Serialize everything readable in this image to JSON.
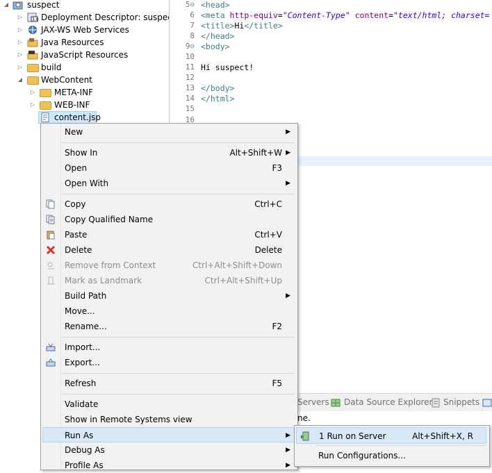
{
  "project_explorer": {
    "project": "suspect",
    "items": [
      {
        "label": "Deployment Descriptor: suspect",
        "icon": "deployment-descriptor-icon"
      },
      {
        "label": "JAX-WS Web Services",
        "icon": "web-services-icon"
      },
      {
        "label": "Java Resources",
        "icon": "java-resources-icon"
      },
      {
        "label": "JavaScript Resources",
        "icon": "javascript-resources-icon"
      },
      {
        "label": "build",
        "icon": "folder-icon"
      },
      {
        "label": "WebContent",
        "icon": "folder-icon"
      },
      {
        "label": "META-INF",
        "icon": "folder-icon"
      },
      {
        "label": "WEB-INF",
        "icon": "folder-icon"
      },
      {
        "label": "content.jsp",
        "icon": "jsp-file-icon"
      }
    ]
  },
  "editor": {
    "lines": [
      {
        "num": "5",
        "marker": "⊖"
      },
      {
        "num": "6"
      },
      {
        "num": "7"
      },
      {
        "num": "8"
      },
      {
        "num": "9",
        "marker": "⊖"
      },
      {
        "num": "10"
      },
      {
        "num": "11"
      },
      {
        "num": "12"
      },
      {
        "num": "13"
      },
      {
        "num": "14"
      },
      {
        "num": "15"
      },
      {
        "num": "16"
      }
    ],
    "code": {
      "l5": "<head>",
      "l6_tag": "<meta ",
      "l6_attr1": "http-equiv",
      "l6_eq1": "=",
      "l6_val1": "\"Content-Type\"",
      "l6_attr2": " content",
      "l6_eq2": "=",
      "l6_val2": "\"text/html; charset=",
      "l7_open": "<title>",
      "l7_text": "Hi",
      "l7_close": "</title>",
      "l8": "</head>",
      "l9": "<body>",
      "l11": "Hi suspect!",
      "l13": "</body>",
      "l14": "</html>"
    }
  },
  "bottom_panel": {
    "tabs": [
      "Servers",
      "Data Source Explorer",
      "Snippets"
    ],
    "status_fragment": "ne."
  },
  "context_menu": {
    "items": [
      {
        "label": "New",
        "arrow": "▶"
      },
      {
        "label": "Show In",
        "shortcut": "Alt+Shift+W",
        "arrow": "▶"
      },
      {
        "label": "Open",
        "shortcut": "F3"
      },
      {
        "label": "Open With",
        "arrow": "▶"
      },
      {
        "label": "Copy",
        "shortcut": "Ctrl+C",
        "icon": "copy-icon"
      },
      {
        "label": "Copy Qualified Name",
        "icon": "copy-qualified-name-icon"
      },
      {
        "label": "Paste",
        "shortcut": "Ctrl+V",
        "icon": "paste-icon"
      },
      {
        "label": "Delete",
        "shortcut": "Delete",
        "icon": "delete-icon"
      },
      {
        "label": "Remove from Context",
        "shortcut": "Ctrl+Alt+Shift+Down",
        "disabled": true,
        "icon": "remove-context-icon"
      },
      {
        "label": "Mark as Landmark",
        "shortcut": "Ctrl+Alt+Shift+Up",
        "disabled": true,
        "icon": "landmark-icon"
      },
      {
        "label": "Build Path",
        "arrow": "▶"
      },
      {
        "label": "Move..."
      },
      {
        "label": "Rename...",
        "shortcut": "F2"
      },
      {
        "label": "Import...",
        "icon": "import-icon"
      },
      {
        "label": "Export...",
        "icon": "export-icon"
      },
      {
        "label": "Refresh",
        "shortcut": "F5"
      },
      {
        "label": "Validate"
      },
      {
        "label": "Show in Remote Systems view"
      },
      {
        "label": "Run As",
        "arrow": "▶",
        "highlighted": true
      },
      {
        "label": "Debug As",
        "arrow": "▶"
      },
      {
        "label": "Profile As",
        "arrow": "▶"
      }
    ]
  },
  "run_as_submenu": {
    "items": [
      {
        "label": "1 Run on Server",
        "shortcut": "Alt+Shift+X, R",
        "icon": "run-on-server-icon"
      },
      {
        "label": "Run Configurations..."
      }
    ]
  },
  "colors": {
    "selection": "#cde8ff",
    "menu_highlight": "#d9e8f7",
    "tag": "#3f7f7f",
    "attribute": "#7f007f",
    "string": "#2a00ff",
    "delete_red": "#d9302b"
  }
}
